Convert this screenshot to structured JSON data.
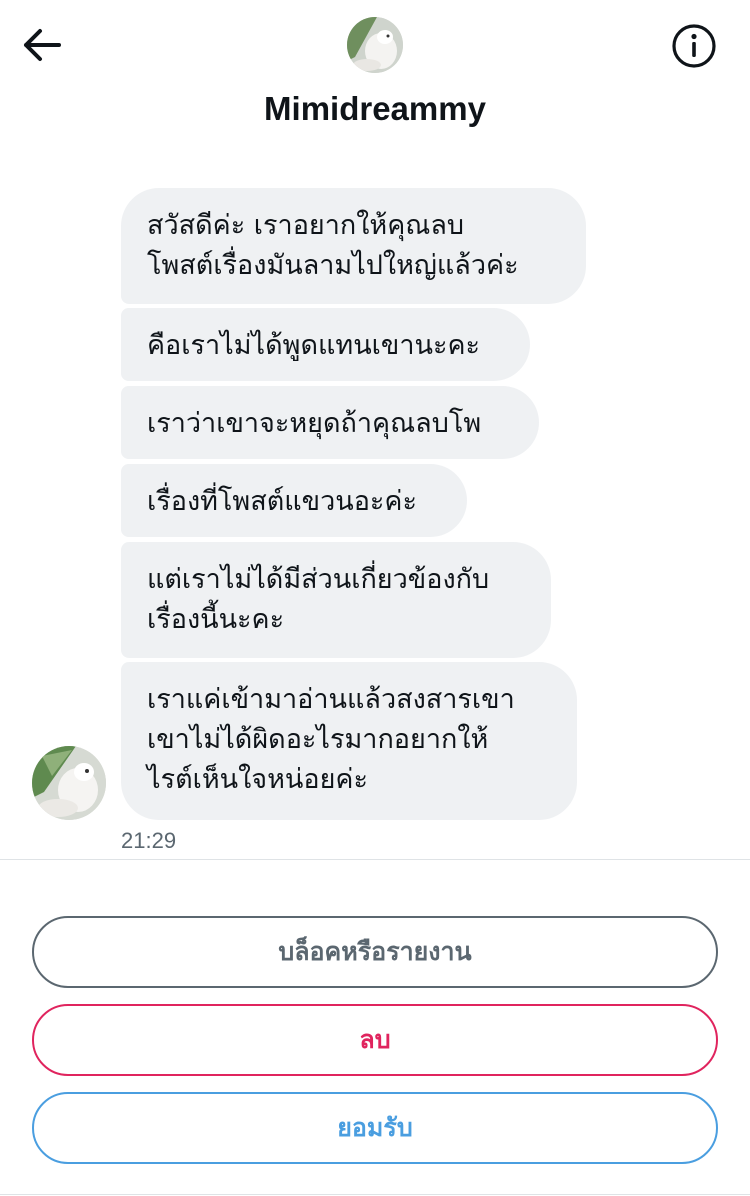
{
  "header": {
    "title": "Mimidreammy",
    "back_icon": "arrow-left-icon",
    "info_icon": "info-circle-icon"
  },
  "messages": [
    {
      "text": "สวัสดีค่ะ เราอยากให้คุณลบ\nโพสต์เรื่องมันลามไปใหญ่แล้วค่ะ"
    },
    {
      "text": "คือเราไม่ได้พูดแทนเขานะคะ"
    },
    {
      "text": "เราว่าเขาจะหยุดถ้าคุณลบโพ"
    },
    {
      "text": "เรื่องที่โพสต์แขวนอะค่ะ"
    },
    {
      "text": "แต่เราไม่ได้มีส่วนเกี่ยวข้องกับ\nเรื่องนี้นะคะ"
    },
    {
      "text": "เราแค่เข้ามาอ่านแล้วสงสารเขา\nเขาไม่ได้ผิดอะไรมากอยากให้\nไรต์เห็นใจหน่อยค่ะ"
    }
  ],
  "timestamp": "21:29",
  "actions": {
    "block_report": "บล็อคหรือรายงาน",
    "delete": "ลบ",
    "accept": "ยอมรับ"
  },
  "colors": {
    "bubble_bg": "#eff1f3",
    "block_border": "#5b6770",
    "delete_red": "#e0245e",
    "accept_blue": "#4a9ee0",
    "text_primary": "#0f1419",
    "text_secondary": "#5b6770"
  }
}
